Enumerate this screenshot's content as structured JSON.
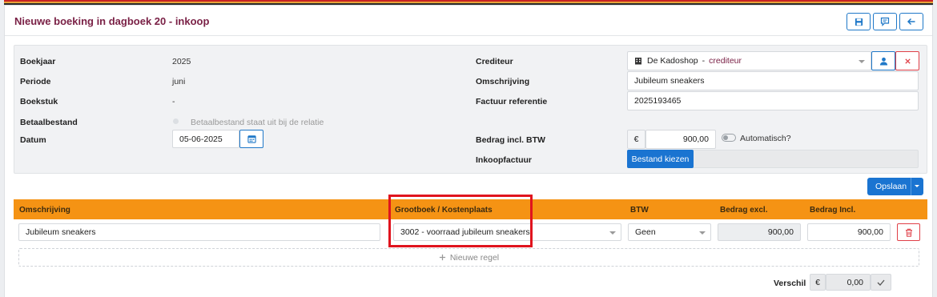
{
  "colors": {
    "accent": "#1a74d1",
    "title": "#7a2146",
    "table_header": "#f59314",
    "highlight": "#e0141e",
    "flag": [
      "#c82324",
      "#e8a33a",
      "#2b2b2b"
    ]
  },
  "header": {
    "title": "Nieuwe boeking in dagboek 20 - inkoop",
    "icons": [
      "save-icon",
      "comment-icon",
      "arrow-left-icon"
    ]
  },
  "form": {
    "boekjaar": {
      "label": "Boekjaar",
      "value": "2025"
    },
    "periode": {
      "label": "Periode",
      "value": "juni"
    },
    "boekstuk": {
      "label": "Boekstuk",
      "value": "-"
    },
    "betaalbestand": {
      "label": "Betaalbestand",
      "value": "Betaalbestand staat uit bij de relatie"
    },
    "datum": {
      "label": "Datum",
      "value": "05-06-2025"
    },
    "crediteur": {
      "label": "Crediteur",
      "name": "De Kadoshop",
      "separator": "-",
      "role": "crediteur"
    },
    "omschrijving": {
      "label": "Omschrijving",
      "value": "Jubileum sneakers"
    },
    "factuur_referentie": {
      "label": "Factuur referentie",
      "value": "2025193465"
    },
    "bedrag": {
      "label": "Bedrag incl. BTW",
      "currency": "€",
      "value": "900,00",
      "auto_label": "Automatisch?"
    },
    "inkoopfactuur": {
      "label": "Inkoopfactuur",
      "button": "Bestand kiezen"
    }
  },
  "save_button": "Opslaan",
  "table": {
    "headers": [
      "Omschrijving",
      "Grootboek / Kostenplaats",
      "BTW",
      "Bedrag excl.",
      "Bedrag Incl."
    ],
    "row": {
      "omschrijving": "Jubileum sneakers",
      "grootboek": "3002 - voorraad jubileum sneakers",
      "btw": "Geen",
      "excl": "900,00",
      "incl": "900,00"
    },
    "new_row": "Nieuwe regel"
  },
  "verschil": {
    "label": "Verschil",
    "currency": "€",
    "value": "0,00"
  }
}
